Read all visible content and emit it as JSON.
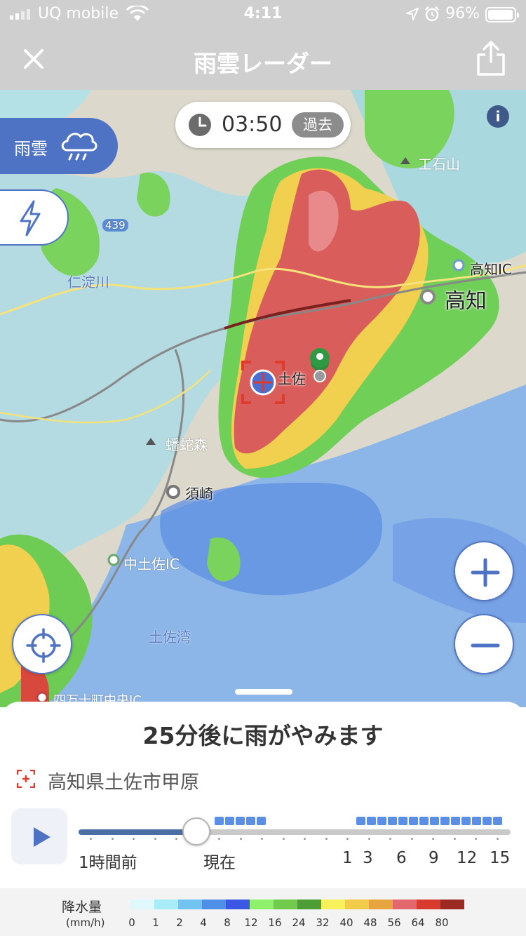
{
  "status_bar": {
    "carrier": "UQ mobile",
    "time": "4:11",
    "battery": "96%"
  },
  "header": {
    "title": "雨雲レーダー"
  },
  "map": {
    "time_display": "03:50",
    "time_badge": "過去",
    "mode_tab_label": "雨雲",
    "info_label": "i",
    "labels": {
      "tosa": "土佐",
      "kochi": "高知",
      "kochi_ic": "高知IC",
      "susaki": "須崎",
      "nakatosa_ic": "中土佐IC",
      "tosa_bay": "土佐湾",
      "niyodo_river": "仁淀川",
      "kukamori": "蟠蛇森",
      "kuishiyama": "工石山",
      "route_439": "439",
      "shimanto_ic": "四万十町中央IC"
    }
  },
  "sheet": {
    "forecast": "25分後に雨がやみます",
    "location": "高知県土佐市甲原",
    "slider": {
      "labels": [
        "1時間前",
        "現在",
        "1",
        "3",
        "6",
        "9",
        "12",
        "15"
      ],
      "current_position": 0.27
    }
  },
  "legend": {
    "title": "降水量",
    "unit": "(mm/h)",
    "values": [
      "0",
      "1",
      "2",
      "4",
      "8",
      "12",
      "16",
      "24",
      "32",
      "40",
      "48",
      "56",
      "64",
      "80"
    ],
    "colors": [
      "#dff8fb",
      "#a8ecf7",
      "#72c3f0",
      "#4f8fe8",
      "#3b57e3",
      "#8ff06c",
      "#72cb4c",
      "#4e9e38",
      "#f7f25c",
      "#f1cc4b",
      "#e8a53f",
      "#e3686d",
      "#d93a2e",
      "#9c2a22"
    ]
  }
}
